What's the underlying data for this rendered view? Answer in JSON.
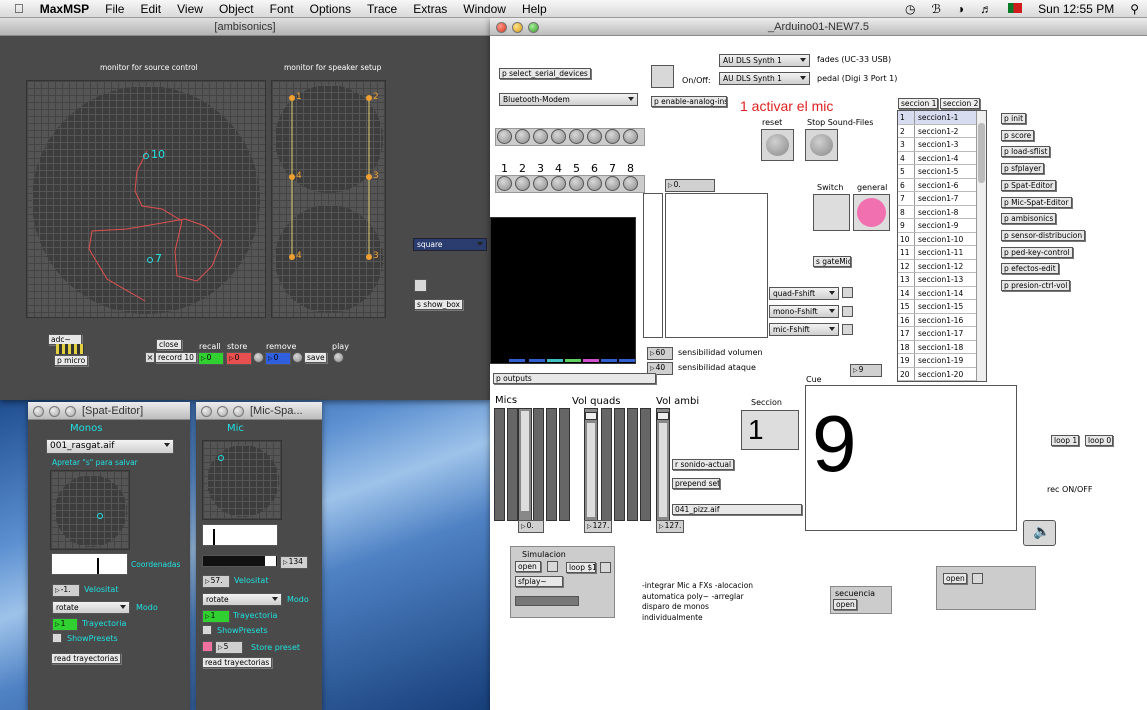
{
  "menubar": {
    "apple": "",
    "app": "MaxMSP",
    "items": [
      "File",
      "Edit",
      "View",
      "Object",
      "Font",
      "Options",
      "Trace",
      "Extras",
      "Window",
      "Help"
    ],
    "clock": "Sun 12:55 PM"
  },
  "ambisonics": {
    "title": "[ambisonics]",
    "monitor_source": "monitor for source control",
    "monitor_speaker": "monitor for speaker setup",
    "source_points": [
      "10",
      "7"
    ],
    "speaker_points": [
      "1",
      "2",
      "4",
      "3",
      "4",
      "3"
    ],
    "dropdown": "square",
    "show_box": "s show_box",
    "adc": "adc~",
    "micro": "p micro",
    "close": "close",
    "recall": "recall",
    "store": "store",
    "remove": "remove",
    "play": "play",
    "record": "record 10",
    "val_recall": "0",
    "val_store": "0",
    "val_remove": "0",
    "save": "save"
  },
  "spat": {
    "title": "[Spat-Editor]",
    "heading": "Monos",
    "file": "001_rasgat.aif",
    "hint": "Apretar \"s\" para salvar",
    "coords": "Coordenadas",
    "velocity_val": "-1.",
    "velocity": "Velositat",
    "mode_val": "rotate",
    "mode": "Modo",
    "traj_val": "1",
    "trajectory": "Trayectoria",
    "show_presets": "ShowPresets",
    "read": "read trayectorias"
  },
  "micspat": {
    "title": "[Mic-Spa...",
    "heading": "Mic",
    "level": "134",
    "velocity_val": "57.",
    "velocity": "Velositat",
    "mode_val": "rotate",
    "mode": "Modo",
    "traj_val": "1",
    "trajectory": "Trayectoria",
    "show_presets": "ShowPresets",
    "store_val": "5",
    "store": "Store preset",
    "read": "read trayectorias"
  },
  "arduino": {
    "title": "_Arduino01-NEW7.5",
    "serial": "p select_serial_devices",
    "bluetooth": "Bluetooth-Modem",
    "enable_analog": "p enable-analog-ins",
    "onoff": "On/Off:",
    "synth1": "AU DLS Synth 1",
    "synth2": "AU DLS Synth 1",
    "fades": "fades (UC-33 USB)",
    "pedal": "pedal (Digi 3 Port 1)",
    "activar": "1 activar el mic",
    "reset": "reset",
    "stop": "Stop Sound-Files",
    "numbers": [
      "1",
      "2",
      "3",
      "4",
      "5",
      "6",
      "7",
      "8"
    ],
    "num_main": "0.",
    "switch": "Switch",
    "general": "general",
    "gatemic": "s gateMic",
    "quad": "quad-Fshift",
    "mono": "mono-Fshift",
    "mic": "mic-Fshift",
    "vol_val": "60",
    "vol_label": "sensibilidad volumen",
    "atk_val": "40",
    "atk_label": "sensibilidad ataque",
    "outputs": "p outputs",
    "mics": "Mics",
    "vol_quads": "Vol quads",
    "vol_ambi": "Vol ambi",
    "seccion": "Seccion",
    "seccion_val": "1",
    "cue": "Cue",
    "cue_val": "9",
    "small_num": "9",
    "sonido": "r sonido-actual",
    "prepend": "prepend set",
    "pizz": "041_pizz.aif",
    "fader_vals": [
      "0.",
      "127.",
      "127."
    ],
    "tabs": [
      "seccion 1",
      "seccion 2"
    ],
    "sections": [
      "seccion1-1",
      "seccion1-2",
      "seccion1-3",
      "seccion1-4",
      "seccion1-5",
      "seccion1-6",
      "seccion1-7",
      "seccion1-8",
      "seccion1-9",
      "seccion1-10",
      "seccion1-11",
      "seccion1-12",
      "seccion1-13",
      "seccion1-14",
      "seccion1-15",
      "seccion1-16",
      "seccion1-17",
      "seccion1-18",
      "seccion1-19",
      "seccion1-20"
    ],
    "subpatches": [
      "p init",
      "p score",
      "p load-sflist",
      "p sfplayer",
      "p Spat-Editor",
      "p Mic-Spat-Editor",
      "p ambisonics",
      "p sensor-distribucion",
      "p ped-key-control",
      "p efectos-edit",
      "p presion-ctrl-vol"
    ],
    "loop1": "loop 1",
    "loop0": "loop 0",
    "rec": "rec ON/OFF",
    "sim_title": "Simulacion",
    "sim_open": "open",
    "sim_loop": "loop $1",
    "sfplay": "sfplay~",
    "notes": "-integrar Mic a FXs -alocacion automatica poly~ -arreglar disparo de monos individualmente",
    "secuencia": "secuencia",
    "sec_open": "open",
    "open2": "open"
  }
}
